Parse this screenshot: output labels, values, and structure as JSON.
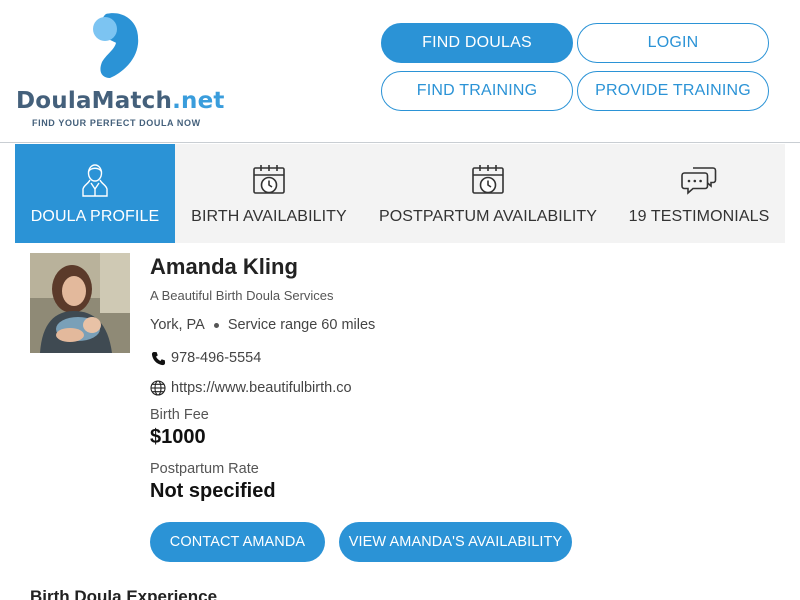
{
  "header": {
    "logo": {
      "word_main": "DoulaMatch",
      "word_accent": ".net",
      "tagline": "FIND YOUR PERFECT DOULA NOW"
    },
    "nav": {
      "find_doulas": "FIND DOULAS",
      "login": "LOGIN",
      "find_training": "FIND TRAINING",
      "provide_training": "PROVIDE TRAINING"
    }
  },
  "tabs": [
    {
      "label": "DOULA PROFILE",
      "icon": "doula-person-icon",
      "active": true
    },
    {
      "label": "BIRTH AVAILABILITY",
      "icon": "calendar-clock-icon",
      "active": false
    },
    {
      "label": "POSTPARTUM AVAILABILITY",
      "icon": "calendar-clock-icon",
      "active": false
    },
    {
      "label": "19 TESTIMONIALS",
      "icon": "chat-bubbles-icon",
      "active": false
    }
  ],
  "profile": {
    "name": "Amanda Kling",
    "business": "A Beautiful Birth Doula Services",
    "location": "York, PA",
    "service_range": "Service range 60 miles",
    "phone": "978-496-5554",
    "website": "https://www.beautifulbirth.co",
    "birth_fee_label": "Birth Fee",
    "birth_fee": "$1000",
    "postpartum_rate_label": "Postpartum Rate",
    "postpartum_rate": "Not specified",
    "contact_button": "CONTACT AMANDA",
    "availability_button": "VIEW AMANDA'S AVAILABILITY"
  },
  "sections": {
    "experience_heading": "Birth Doula Experience"
  },
  "colors": {
    "brand_blue": "#2b93d6",
    "logo_navy": "#44607b",
    "tab_bar_bg": "#f3f3f3"
  }
}
